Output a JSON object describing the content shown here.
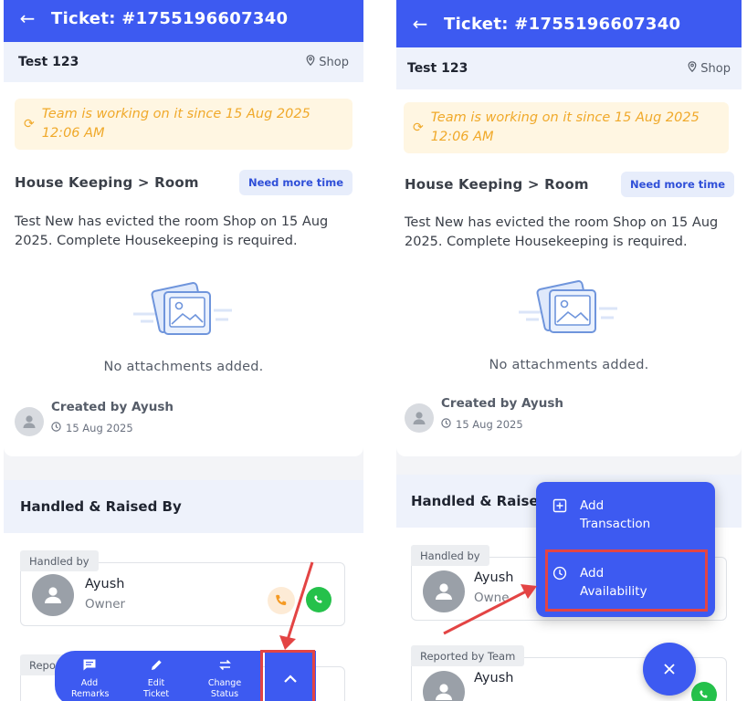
{
  "ticket": {
    "title": "Ticket: #1755196607340",
    "name": "Test 123",
    "location": "Shop",
    "status_banner": "Team is working on it since 15 Aug 2025 12:06 AM",
    "category_path": "House Keeping > Room",
    "need_more_time_label": "Need more time",
    "description": "Test New has evicted the room Shop on 15 Aug 2025. Complete Housekeeping is required.",
    "no_attachments": "No attachments added.",
    "created_by": "Created by Ayush",
    "created_date": "15 Aug 2025"
  },
  "handled_section": {
    "title": "Handled & Raised By",
    "title_partial": "Handled & Raised By",
    "handled_by_label": "Handled by",
    "handler_name": "Ayush",
    "handler_role": "Owner",
    "handler_role_partial": "Owne",
    "reported_by_label": "Reported by Team",
    "reported_by_label_partial": "Repor",
    "reporter_name": "Ayush",
    "reporter_name_partial": "sh"
  },
  "bottom_bar": {
    "items": [
      {
        "label": "Add Remarks",
        "icon": "chat-icon"
      },
      {
        "label": "Edit Ticket",
        "icon": "pencil-icon"
      },
      {
        "label": "Change Status",
        "icon": "swap-icon"
      }
    ],
    "expand_icon": "chevron-up-icon"
  },
  "fab_menu": {
    "items": [
      {
        "label": "Add Transaction",
        "icon": "plus-square-icon"
      },
      {
        "label": "Add Availability",
        "icon": "clock-icon"
      }
    ],
    "close_icon": "close-icon"
  },
  "colors": {
    "primary": "#3d5af1",
    "banner_text": "#f0a92a",
    "banner_bg": "#fff6e2",
    "annotation_red": "#e34444",
    "whatsapp": "#25c14b",
    "phone_orange": "#f59a23"
  }
}
